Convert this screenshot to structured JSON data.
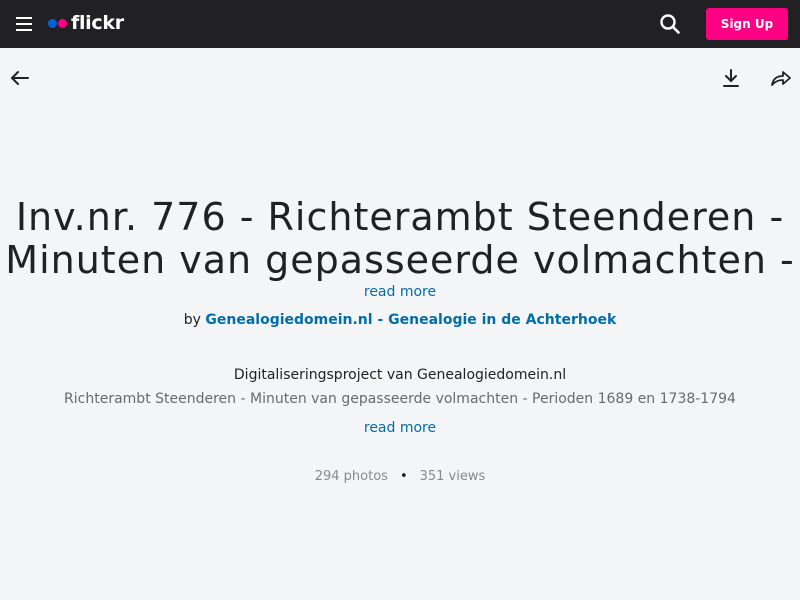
{
  "header": {
    "logo_text": "flickr",
    "signup_label": "Sign Up",
    "colors": {
      "bar": "#212124",
      "accent": "#ff0084",
      "logo_blue": "#0063dc",
      "logo_pink": "#ff0084"
    },
    "icons": [
      "menu-icon",
      "search-icon"
    ]
  },
  "toolbar": {
    "icons": [
      "arrow-left-icon",
      "download-icon",
      "share-icon"
    ]
  },
  "album": {
    "title": "Inv.nr. 776 - Richterambt Steenderen - Minuten van gepasseerde volmachten -",
    "read_more": "read more",
    "by_label": "by",
    "owner": "Genealogiedomein.nl - Genealogie in de Achterhoek",
    "description_line1": "Digitaliseringsproject van Genealogiedomein.nl",
    "description_line2": "Richterambt Steenderen - Minuten van gepasseerde volmachten - Perioden 1689 en 1738-1794",
    "description_read_more": "read more",
    "photos": "294 photos",
    "separator": "•",
    "views": "351 views",
    "link_color": "#006dac"
  }
}
